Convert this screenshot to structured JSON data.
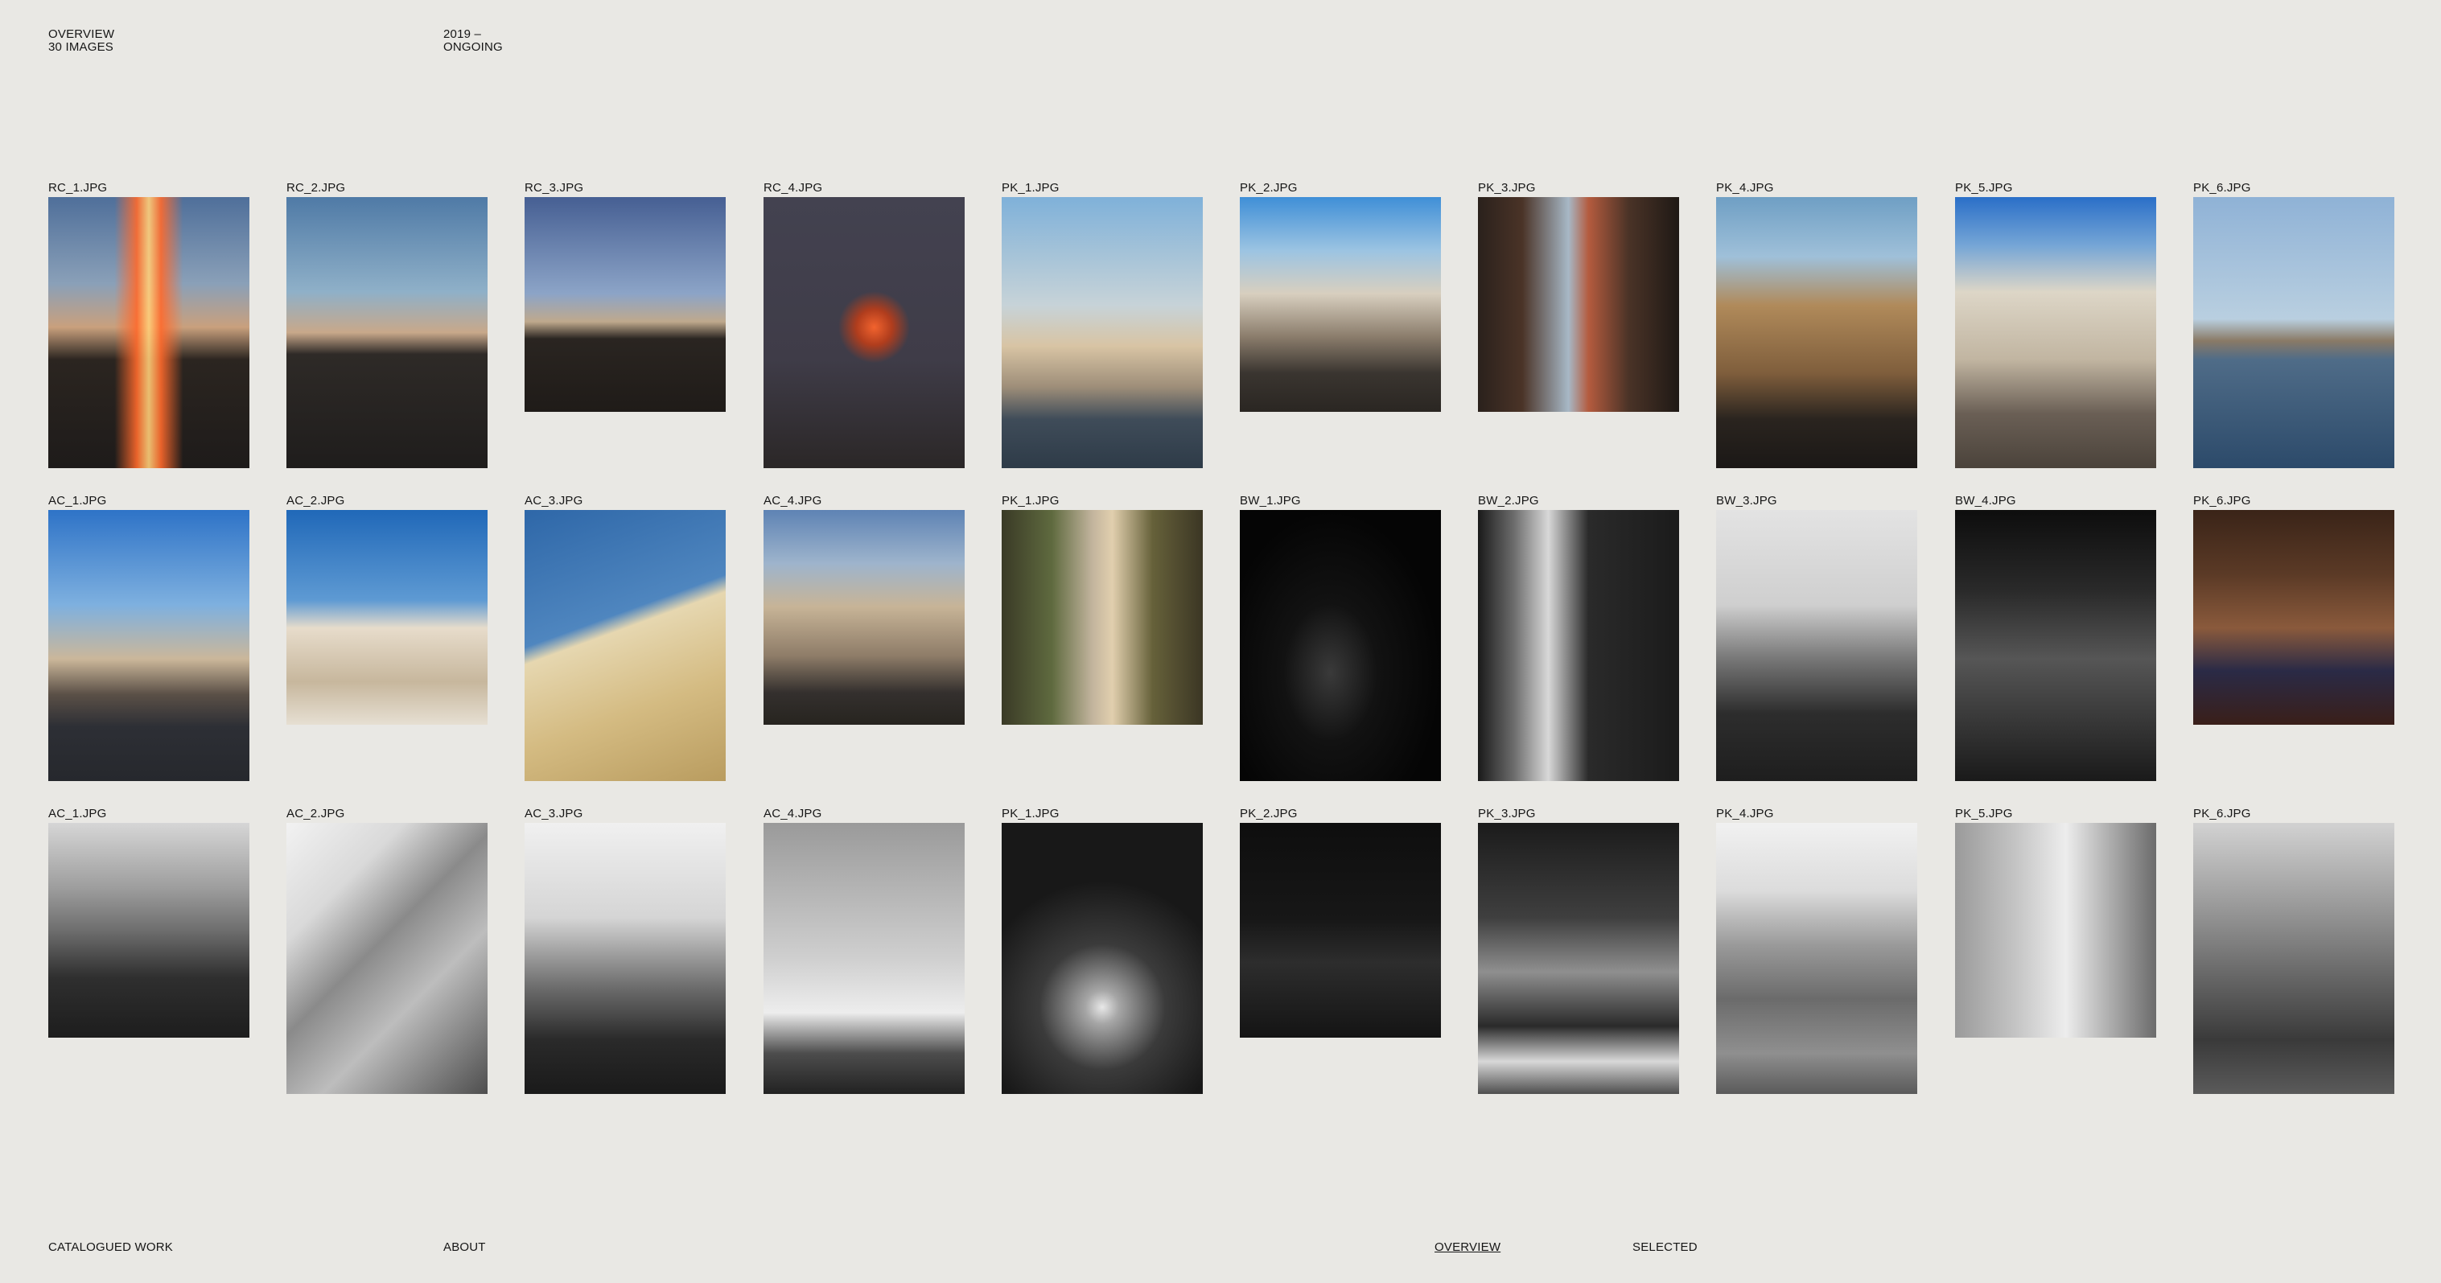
{
  "header": {
    "section": "OVERVIEW",
    "count": "30 IMAGES",
    "date_range": "2019 –",
    "status": "ONGOING"
  },
  "footer": {
    "catalogued": "CATALOGUED WORK",
    "about": "ABOUT",
    "overview": "OVERVIEW",
    "selected": "SELECTED"
  },
  "rows": [
    {
      "items": [
        {
          "label": "RC_1.JPG",
          "size": "tall",
          "bg": "linear-gradient(180deg,#4f6f9a 0%,#8aa0b8 32%,#c9a07d 48%,#2b2520 60%,#1e1b1a 100%)",
          "accent": "linear-gradient(90deg,transparent 0%,transparent 33%,#ff6a2c 44%,#ffd07a 50%,#ff6a2c 56%,transparent 67%,transparent 100%)"
        },
        {
          "label": "RC_2.JPG",
          "size": "tall",
          "bg": "linear-gradient(180deg,#4f7aa6 0%,#8fb0c8 35%,#c8a88a 50%,#2e2a27 58%,#1f1d1c 100%)",
          "accent": ""
        },
        {
          "label": "RC_3.JPG",
          "size": "short",
          "bg": "linear-gradient(180deg,#465f93 0%,#8ca4c7 45%,#bfa98d 58%,#2a2521 66%,#1f1b18 100%)",
          "accent": ""
        },
        {
          "label": "RC_4.JPG",
          "size": "tall",
          "bg": "radial-gradient(circle at 55% 48%,#f2632e 0%,#b03d1d 10%,transparent 20%),linear-gradient(180deg,#434250 0%,#3f3c48 60%,#2b2727 100%)",
          "accent": ""
        },
        {
          "label": "PK_1.JPG",
          "size": "tall",
          "bg": "linear-gradient(180deg,#7fb1d9 0%,#c7d3d8 40%,#d8c4a4 55%,#9e8e79 70%,#3f4c59 82%,#2e3b48 100%)",
          "accent": ""
        },
        {
          "label": "PK_2.JPG",
          "size": "short",
          "bg": "linear-gradient(180deg,#3f8fd7 0%,#9cc4e2 25%,#d8cfbf 45%,#8b7d6c 65%,#3a3530 82%,#2a2622 100%)",
          "accent": ""
        },
        {
          "label": "PK_3.JPG",
          "size": "short",
          "bg": "linear-gradient(90deg,#2a211c 0%,#4a3327 22%,#a7b8c6 45%,#b45b3e 55%,#4a3327 75%,#1f1915 100%)",
          "accent": ""
        },
        {
          "label": "PK_4.JPG",
          "size": "tall",
          "bg": "linear-gradient(180deg,#6f9fc4 0%,#9fc0d9 22%,#b08a5a 40%,#7f5e3c 65%,#2a241f 82%,#1b1816 100%)",
          "accent": ""
        },
        {
          "label": "PK_5.JPG",
          "size": "tall",
          "bg": "linear-gradient(180deg,#2a6fc8 0%,#76a6d6 18%,#ddd6c7 35%,#c1b5a1 60%,#6a5f55 80%,#4b433b 100%)",
          "accent": ""
        },
        {
          "label": "PK_6.JPG",
          "size": "tall",
          "bg": "linear-gradient(180deg,#8fb2d6 0%,#b9cfe0 45%,#8a7a66 53%,#4f6c88 60%,#2c4a6a 100%)",
          "accent": ""
        }
      ]
    },
    {
      "items": [
        {
          "label": "AC_1.JPG",
          "size": "tall",
          "bg": "linear-gradient(180deg,#2e73c7 0%,#7eb0df 35%,#cbb79a 55%,#5b5047 68%,#2d2f35 80%,#26282d 100%)",
          "accent": ""
        },
        {
          "label": "AC_2.JPG",
          "size": "short",
          "bg": "linear-gradient(180deg,#2068b8 0%,#5e9ad3 42%,#e7dccb 55%,#c7b79d 80%,#e6dfd2 100%)",
          "accent": ""
        },
        {
          "label": "AC_3.JPG",
          "size": "tall",
          "bg": "linear-gradient(160deg,#2e67a8 0%,#4f86bf 40%,#e6d7b0 45%,#d4bb82 70%,#b99c5f 100%)",
          "accent": ""
        },
        {
          "label": "AC_4.JPG",
          "size": "short",
          "bg": "linear-gradient(180deg,#5e83b4 0%,#9eb4cc 25%,#c7b497 45%,#8e7c68 68%,#34302e 85%,#27241f 100%)",
          "accent": ""
        },
        {
          "label": "PK_1.JPG",
          "size": "short",
          "bg": "linear-gradient(90deg,#3a3a26 0%,#5f6a3f 25%,#c2b49d 45%,#e1cfae 55%,#66613a 75%,#3b3624 100%)",
          "accent": ""
        },
        {
          "label": "BW_1.JPG",
          "size": "tall",
          "bg": "radial-gradient(ellipse at 45% 60%,#3a3a3a 0%,#121212 30%,#050505 70%)",
          "accent": ""
        },
        {
          "label": "BW_2.JPG",
          "size": "tall",
          "bg": "linear-gradient(90deg,#1a1a1a 0%,#6d6d6d 18%,#d8d8d8 35%,#2a2a2a 55%,#1b1b1b 100%)",
          "accent": ""
        },
        {
          "label": "BW_3.JPG",
          "size": "tall",
          "bg": "linear-gradient(180deg,#e3e3e3 0%,#cfcfcf 35%,#777777 55%,#2d2d2d 75%,#1e1e1e 100%)",
          "accent": ""
        },
        {
          "label": "BW_4.JPG",
          "size": "tall",
          "bg": "linear-gradient(180deg,#0d0d0d 0%,#2a2a2a 30%,#565656 55%,#1a1a1a 100%)",
          "accent": ""
        },
        {
          "label": "PK_6.JPG",
          "size": "short",
          "bg": "linear-gradient(180deg,#3a2418 0%,#5b3a26 30%,#8a5a3c 55%,#2a2a46 75%,#3a1f19 100%)",
          "accent": ""
        }
      ]
    },
    {
      "items": [
        {
          "label": "AC_1.JPG",
          "size": "short",
          "bg": "linear-gradient(180deg,#d6d6d6 0%,#9e9e9e 30%,#6e6e6e 50%,#2f2f2f 72%,#1d1d1d 100%)",
          "accent": ""
        },
        {
          "label": "AC_2.JPG",
          "size": "tall",
          "bg": "linear-gradient(135deg,#f2f2f2 0%,#d9d9d9 25%,#8a8a8a 45%,#bdbdbd 65%,#4e4e4e 100%)",
          "accent": ""
        },
        {
          "label": "AC_3.JPG",
          "size": "tall",
          "bg": "linear-gradient(180deg,#f0f0f0 0%,#d5d5d5 35%,#6f6f6f 60%,#2a2a2a 80%,#1a1a1a 100%)",
          "accent": ""
        },
        {
          "label": "AC_4.JPG",
          "size": "tall",
          "bg": "linear-gradient(180deg,#9a9a9a 0%,#cfcfcf 50%,#ededed 70%,#4d4d4d 85%,#222222 100%)",
          "accent": ""
        },
        {
          "label": "PK_1.JPG",
          "size": "tall",
          "bg": "radial-gradient(circle at 50% 68%,#e8e8e8 0%,#a6a6a6 8%,#3b3b3b 30%,#181818 60%),linear-gradient(180deg,#2d2d2d 0%,#111111 100%)",
          "accent": ""
        },
        {
          "label": "PK_2.JPG",
          "size": "short",
          "bg": "linear-gradient(180deg,#0e0e0e 0%,#171717 45%,#2d2d2d 65%,#141414 100%)",
          "accent": ""
        },
        {
          "label": "PK_3.JPG",
          "size": "tall",
          "bg": "linear-gradient(180deg,#1b1b1b 0%,#3f3f3f 35%,#8f8f8f 55%,#2a2a2a 75%,#d8d8d8 88%,#4e4e4e 100%)",
          "accent": ""
        },
        {
          "label": "PK_4.JPG",
          "size": "tall",
          "bg": "linear-gradient(180deg,#f1f1f1 0%,#dcdcdc 25%,#9a9a9a 45%,#6b6b6b 65%,#8f8f8f 85%,#5a5a5a 100%)",
          "accent": ""
        },
        {
          "label": "PK_5.JPG",
          "size": "short",
          "bg": "linear-gradient(90deg,#9a9a9a 0%,#c4c4c4 30%,#ededed 55%,#b3b3b3 75%,#6b6b6b 100%)",
          "accent": ""
        },
        {
          "label": "PK_6.JPG",
          "size": "tall",
          "bg": "linear-gradient(180deg,#d2d2d2 0%,#9b9b9b 30%,#6a6a6a 55%,#3a3a3a 80%,#5a5a5a 100%)",
          "accent": ""
        }
      ]
    }
  ]
}
